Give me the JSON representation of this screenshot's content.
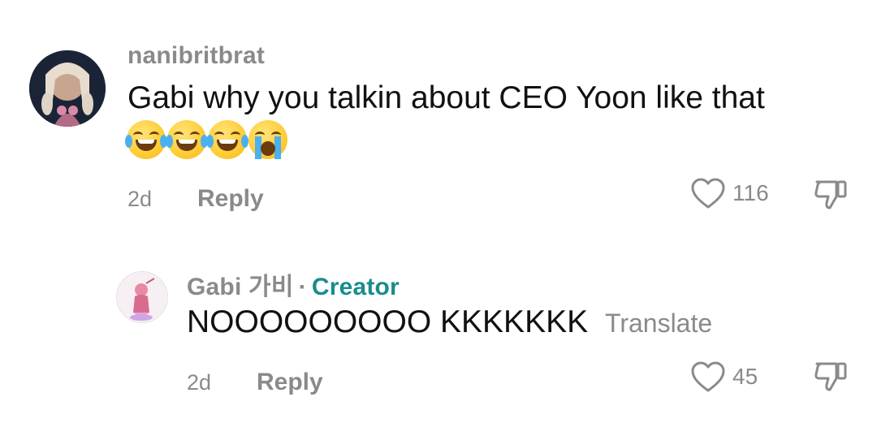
{
  "comments": [
    {
      "username": "nanibritbrat",
      "text": "Gabi why you talkin about CEO Yoon like that",
      "emojis": [
        "joy-face",
        "joy-face",
        "joy-face",
        "loudly-crying-face"
      ],
      "time": "2d",
      "reply_label": "Reply",
      "likes": "116"
    },
    {
      "username": "Gabi 가비",
      "separator": "·",
      "badge": "Creator",
      "text": "NOOOOOOOOO KKKKKKK",
      "translate_label": "Translate",
      "time": "2d",
      "reply_label": "Reply",
      "likes": "45"
    }
  ],
  "colors": {
    "muted": "#8a8a8a",
    "creator": "#1a8c8c",
    "text": "#111111"
  }
}
